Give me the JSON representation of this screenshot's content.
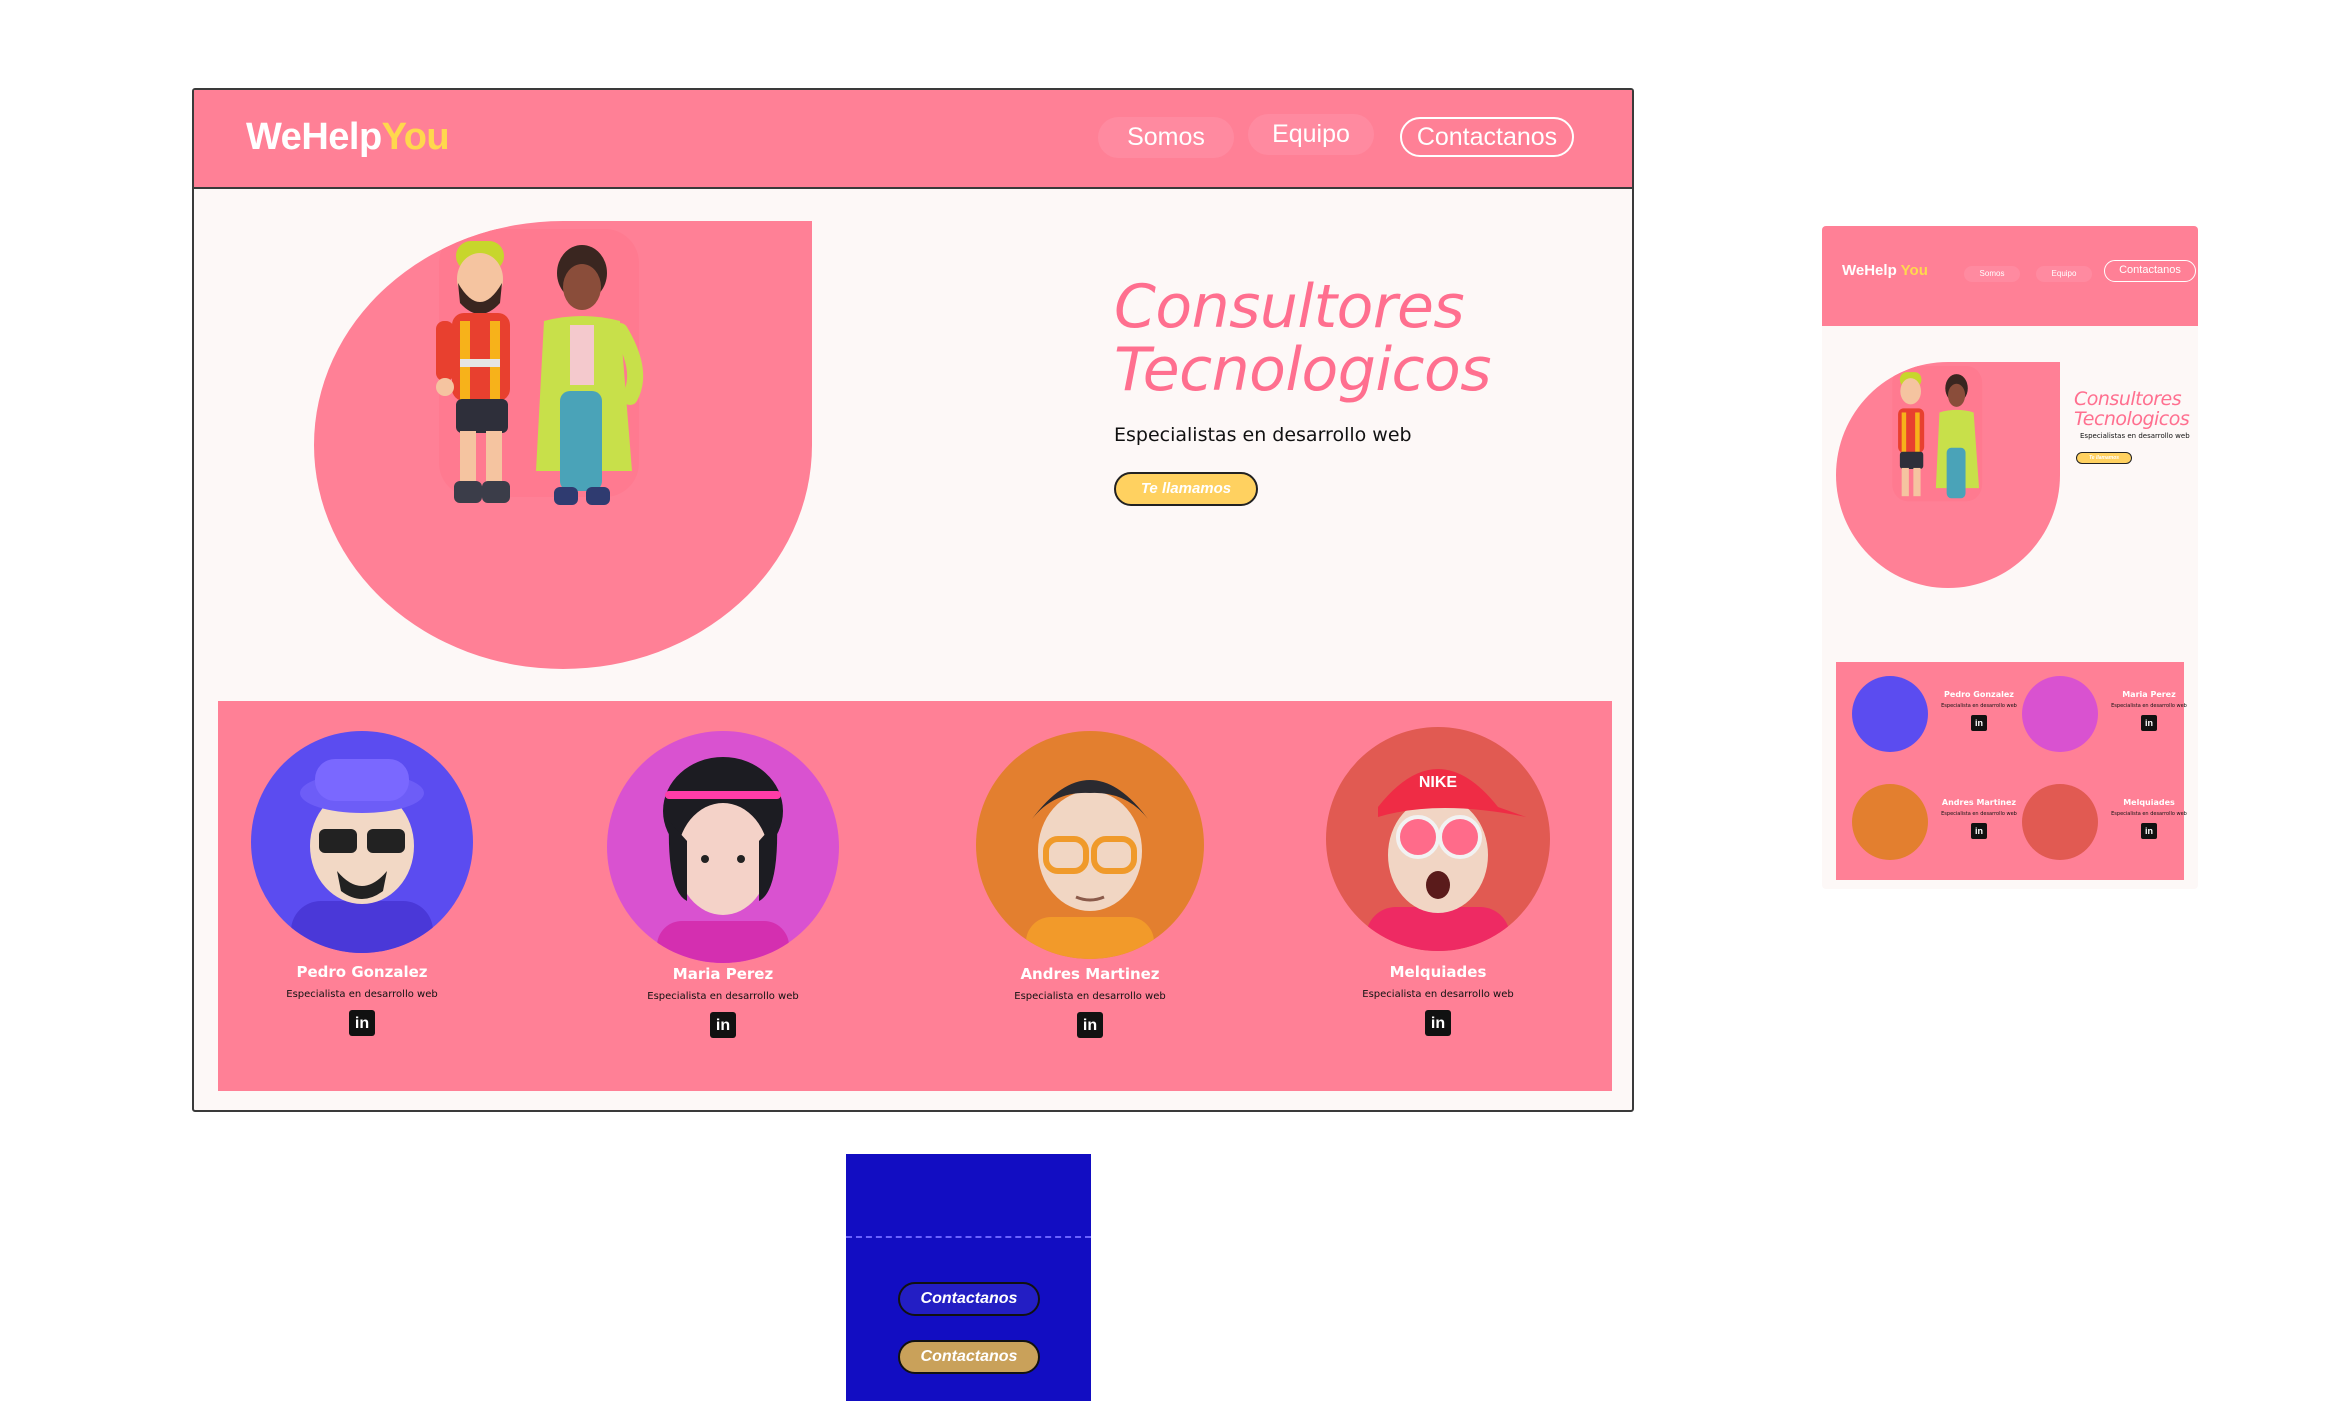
{
  "brand": {
    "name_part1": "WeHelp",
    "name_part2": "You",
    "accent_color": "#ffd84d",
    "primary_color": "#ff8096"
  },
  "nav": {
    "somos": "Somos",
    "equipo": "Equipo",
    "contactanos": "Contactanos"
  },
  "hero": {
    "title_line1": "Consultores",
    "title_line2": "Tecnologicos",
    "subtitle": "Especialistas en desarrollo web",
    "cta": "Te llamamos"
  },
  "team": [
    {
      "name": "Pedro Gonzalez",
      "role": "Especialista en desarrollo web",
      "icon": "linkedin-icon"
    },
    {
      "name": "Maria Perez",
      "role": "Especialista en desarrollo web",
      "icon": "linkedin-icon"
    },
    {
      "name": "Andres Martinez",
      "role": "Especialista en desarrollo web",
      "icon": "linkedin-icon"
    },
    {
      "name": "Melquiades",
      "role": "Especialista en desarrollo web",
      "icon": "linkedin-icon"
    }
  ],
  "avatar_badge": "NIKE",
  "linkedin_glyph": "in",
  "button_states": {
    "default_label": "Contactanos",
    "hover_label": "Contactanos",
    "frame_color": "#120dc2"
  }
}
